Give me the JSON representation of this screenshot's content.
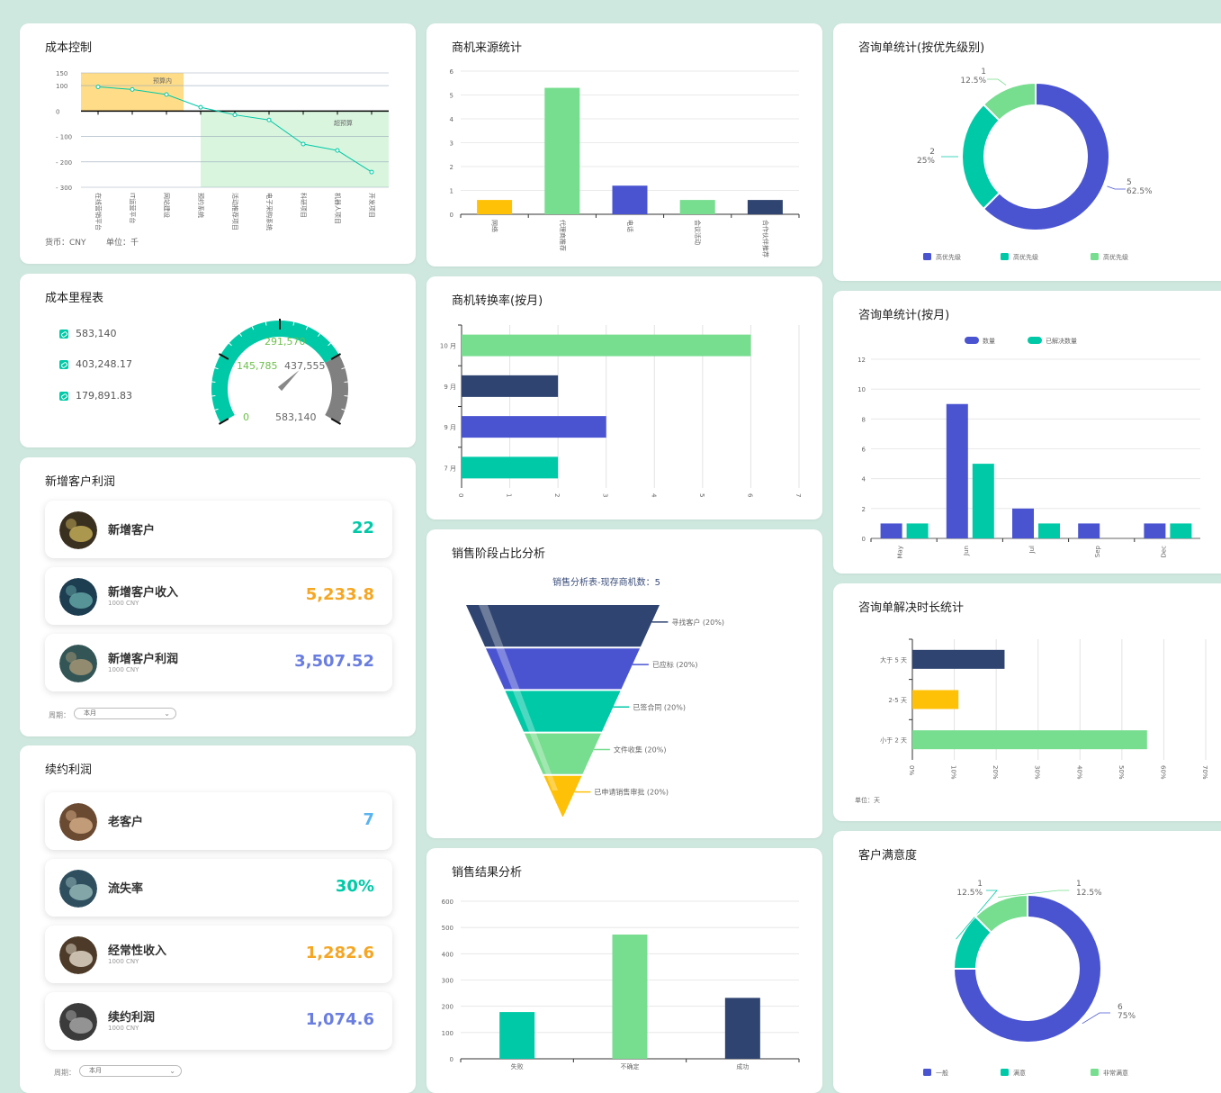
{
  "colors": {
    "green": "#77dd8f",
    "teal": "#00c9a7",
    "navy": "#2f4470",
    "blue": "#4a54d1",
    "yellow": "#ffc107",
    "gray": "#808080",
    "orange": "#f5a623",
    "budget_bg": "#ffdd88",
    "over_bg": "#d9f5de"
  },
  "cost_control": {
    "title": "成本控制",
    "currency": "货币：CNY",
    "unit": "单位：千",
    "annotations": {
      "in_budget": "预算内",
      "over_budget": "超预算"
    },
    "chart_data": {
      "type": "line",
      "categories": [
        "在线营销平台",
        "IT运营平台",
        "网站建设",
        "预约系统",
        "活动推荐项目",
        "电子采购系统",
        "科研项目",
        "机器人项目",
        "开发项目"
      ],
      "values": [
        95,
        85,
        65,
        15,
        -15,
        -35,
        -130,
        -155,
        -240
      ],
      "ylim": [
        -300,
        150
      ],
      "yticks": [
        150,
        100,
        0,
        -100,
        -200,
        -300
      ],
      "ytick_labels": [
        "150",
        "100",
        "0",
        "- 100",
        "- 200",
        "- 300"
      ]
    }
  },
  "cost_milestone": {
    "title": "成本里程表",
    "items": [
      "583,140",
      "403,248.17",
      "179,891.83"
    ],
    "gauge": {
      "min_label": "0",
      "max_label": "583,140",
      "marks": [
        "145,785",
        "291,570",
        "437,555"
      ],
      "value": 403248.17,
      "max": 583140
    }
  },
  "new_customer_profit": {
    "title": "新增客户利润",
    "rows": [
      {
        "label": "新增客户",
        "sub": "",
        "value": "22",
        "color": "#00c9a7"
      },
      {
        "label": "新增客户收入",
        "sub": "1000 CNY",
        "value": "5,233.8",
        "color": "#f5a623"
      },
      {
        "label": "新增客户利润",
        "sub": "1000 CNY",
        "value": "3,507.52",
        "color": "#6a7ee0"
      }
    ],
    "period_label": "周期：",
    "period_value": "本月"
  },
  "renewal_profit": {
    "title": "续约利润",
    "rows": [
      {
        "label": "老客户",
        "sub": "",
        "value": "7",
        "color": "#5ab4f0"
      },
      {
        "label": "流失率",
        "sub": "",
        "value": "30%",
        "color": "#00c9a7"
      },
      {
        "label": "经常性收入",
        "sub": "1000 CNY",
        "value": "1,282.6",
        "color": "#f5a623"
      },
      {
        "label": "续约利润",
        "sub": "1000 CNY",
        "value": "1,074.6",
        "color": "#6a7ee0"
      }
    ],
    "period_label": "周期：",
    "period_value": "本月"
  },
  "lead_source": {
    "title": "商机来源统计",
    "chart_data": {
      "type": "bar",
      "categories": [
        "网络",
        "代理商推荐",
        "电话",
        "会议活动",
        "合作伙伴推荐"
      ],
      "values": [
        0.6,
        5.3,
        1.2,
        0.6,
        0.6
      ],
      "colors": [
        "#ffc107",
        "#77dd8f",
        "#4a54d1",
        "#77dd8f",
        "#2f4470"
      ],
      "ylim": [
        0,
        6
      ],
      "yticks": [
        0,
        1,
        2,
        3,
        4,
        5,
        6
      ]
    }
  },
  "lead_conversion": {
    "title": "商机转换率(按月)",
    "chart_data": {
      "type": "bar",
      "orientation": "horizontal",
      "categories": [
        "10 月",
        "9 月",
        "9 月",
        "7 月"
      ],
      "values": [
        6,
        2,
        3,
        2
      ],
      "colors": [
        "#77dd8f",
        "#2f4470",
        "#4a54d1",
        "#00c9a7"
      ],
      "xlim": [
        0,
        7
      ],
      "xticks": [
        0,
        1,
        2,
        3,
        4,
        5,
        6,
        7
      ]
    }
  },
  "sales_stage": {
    "title": "销售阶段占比分析",
    "subtitle": "销售分析表-现存商机数：5",
    "stages": [
      {
        "label": "寻找客户 (20%)",
        "color": "#2f4470"
      },
      {
        "label": "已应标 (20%)",
        "color": "#4a54d1"
      },
      {
        "label": "已签合同 (20%)",
        "color": "#00c9a7"
      },
      {
        "label": "文件收集 (20%)",
        "color": "#77dd8f"
      },
      {
        "label": "已申请销售审批 (20%)",
        "color": "#ffc107"
      }
    ]
  },
  "sales_result": {
    "title": "销售结果分析",
    "chart_data": {
      "type": "bar",
      "categories": [
        "失败",
        "不确定",
        "成功"
      ],
      "values": [
        178,
        473,
        232
      ],
      "colors": [
        "#00c9a7",
        "#77dd8f",
        "#2f4470"
      ],
      "ylim": [
        0,
        600
      ],
      "yticks": [
        0,
        100,
        200,
        300,
        400,
        500,
        600
      ]
    }
  },
  "consult_priority": {
    "title": "咨询单统计(按优先级别)",
    "chart_data": {
      "type": "pie",
      "labels": [
        "高优先级",
        "高优先级",
        "高优先级"
      ],
      "values": [
        5,
        2,
        1
      ],
      "percents": [
        "62.5%",
        "25%",
        "12.5%"
      ],
      "colors": [
        "#4a54d1",
        "#00c9a7",
        "#77dd8f"
      ]
    }
  },
  "consult_monthly": {
    "title": "咨询单统计(按月)",
    "chart_data": {
      "type": "bar",
      "categories": [
        "May",
        "Jun",
        "Jul",
        "Sep",
        "Dec"
      ],
      "series": [
        {
          "name": "数量",
          "values": [
            1,
            9,
            2,
            1,
            1
          ],
          "color": "#4a54d1"
        },
        {
          "name": "已解决数量",
          "values": [
            1,
            5,
            1,
            0,
            1
          ],
          "color": "#00c9a7"
        }
      ],
      "ylim": [
        0,
        12
      ],
      "yticks": [
        0,
        2,
        4,
        6,
        8,
        10,
        12
      ]
    }
  },
  "consult_duration": {
    "title": "咨询单解决时长统计",
    "unit": "单位：天",
    "chart_data": {
      "type": "bar",
      "orientation": "horizontal",
      "categories": [
        "大于 5 天",
        "2-5 天",
        "小于 2 天"
      ],
      "values": [
        22,
        11,
        56
      ],
      "colors": [
        "#2f4470",
        "#ffc107",
        "#77dd8f"
      ],
      "xlim": [
        0,
        70
      ],
      "xticks": [
        "0%",
        "10%",
        "20%",
        "30%",
        "40%",
        "50%",
        "60%",
        "70%"
      ]
    }
  },
  "satisfaction": {
    "title": "客户满意度",
    "chart_data": {
      "type": "pie",
      "labels": [
        "一般",
        "满意",
        "非常满意"
      ],
      "values": [
        6,
        1,
        1
      ],
      "percents": [
        "75%",
        "12.5%",
        "12.5%"
      ],
      "colors": [
        "#4a54d1",
        "#00c9a7",
        "#77dd8f"
      ]
    }
  }
}
